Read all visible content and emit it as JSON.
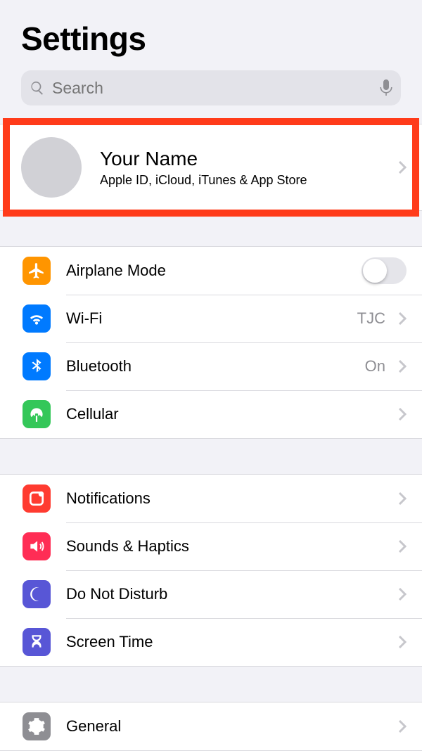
{
  "header": {
    "title": "Settings"
  },
  "search": {
    "placeholder": "Search"
  },
  "profile": {
    "name": "Your Name",
    "subtitle": "Apple ID, iCloud, iTunes & App Store"
  },
  "groups": [
    {
      "rows": [
        {
          "id": "airplane",
          "label": "Airplane Mode",
          "type": "toggle",
          "toggle_on": false
        },
        {
          "id": "wifi",
          "label": "Wi-Fi",
          "type": "nav",
          "detail": "TJC"
        },
        {
          "id": "bluetooth",
          "label": "Bluetooth",
          "type": "nav",
          "detail": "On"
        },
        {
          "id": "cellular",
          "label": "Cellular",
          "type": "nav",
          "detail": ""
        }
      ]
    },
    {
      "rows": [
        {
          "id": "notifications",
          "label": "Notifications",
          "type": "nav",
          "detail": ""
        },
        {
          "id": "sounds",
          "label": "Sounds & Haptics",
          "type": "nav",
          "detail": ""
        },
        {
          "id": "dnd",
          "label": "Do Not Disturb",
          "type": "nav",
          "detail": ""
        },
        {
          "id": "screentime",
          "label": "Screen Time",
          "type": "nav",
          "detail": ""
        }
      ]
    },
    {
      "rows": [
        {
          "id": "general",
          "label": "General",
          "type": "nav",
          "detail": ""
        }
      ]
    }
  ]
}
